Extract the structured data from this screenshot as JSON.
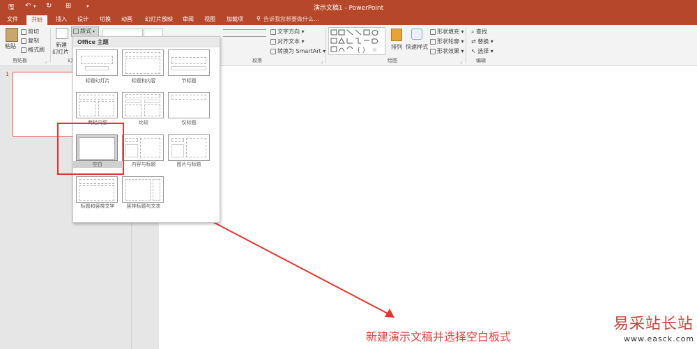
{
  "window": {
    "title": "演示文稿1 - PowerPoint",
    "search_hint": "告诉我您想要做什么..."
  },
  "tabs": [
    "文件",
    "开始",
    "插入",
    "设计",
    "切换",
    "动画",
    "幻灯片放映",
    "审阅",
    "视图",
    "加载项"
  ],
  "active_tab": "开始",
  "ribbon": {
    "clipboard": {
      "paste": "粘贴",
      "cut": "剪切",
      "copy": "复制",
      "format_painter": "格式刷",
      "label": "剪贴板"
    },
    "slides": {
      "new_slide": "新建",
      "new_slide2": "幻灯片",
      "layout_button": "版式",
      "label": "幻"
    },
    "paragraph": {
      "text_direction": "文字方向",
      "align_text": "对齐文本",
      "convert_smartart": "转换为 SmartArt",
      "label": "段落"
    },
    "drawing": {
      "arrange": "排列",
      "quick_styles": "快速样式",
      "shape_fill": "形状填充",
      "shape_outline": "形状轮廓",
      "shape_effects": "形状效果",
      "label": "绘图"
    },
    "editing": {
      "find": "查找",
      "replace": "替换",
      "select": "选择",
      "label": "编辑"
    }
  },
  "slide_panel": {
    "slide_number": "1"
  },
  "layout_gallery": {
    "header": "Office 主题",
    "layouts": [
      "标题幻灯片",
      "标题和内容",
      "节标题",
      "两栏内容",
      "比较",
      "仅标题",
      "空白",
      "内容与标题",
      "图片与标题",
      "标题和竖排文字",
      "竖排标题与文本"
    ],
    "selected": "空白"
  },
  "annotation": {
    "text": "新建演示文稿并选择空白板式",
    "color": "#e0413c"
  },
  "watermark": {
    "brand": "易采站长站",
    "url": "www.easck.com"
  },
  "colors": {
    "accent": "#b7472a",
    "highlight": "#e3342f"
  }
}
